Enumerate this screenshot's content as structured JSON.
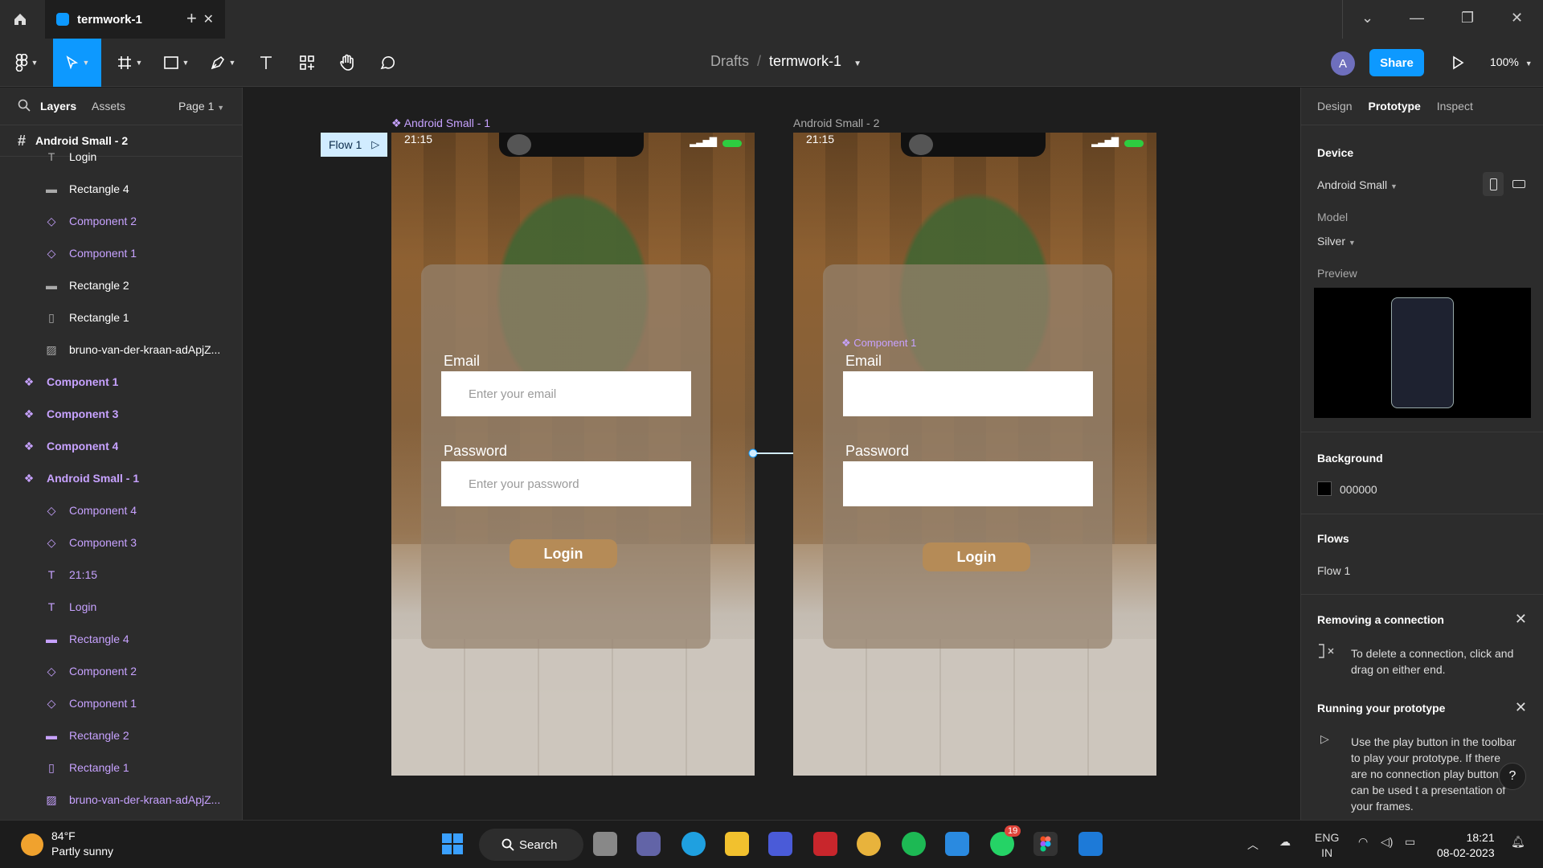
{
  "titlebar": {
    "tab_title": "termwork-1",
    "tab_close": "✕",
    "new_tab": "+",
    "window_controls": [
      "⌄",
      "—",
      "❐",
      "✕"
    ]
  },
  "toolbar": {
    "breadcrumb_drafts": "Drafts",
    "breadcrumb_sep": "/",
    "file_name": "termwork-1",
    "avatar_initial": "A",
    "share_label": "Share",
    "zoom": "100%"
  },
  "left_panel": {
    "tabs": {
      "layers": "Layers",
      "assets": "Assets",
      "page": "Page 1"
    },
    "selected_frame": "Android Small - 2",
    "layers": [
      {
        "name": "Login",
        "icon": "text-icon",
        "component": false,
        "bold": false
      },
      {
        "name": "Rectangle 4",
        "icon": "line-icon",
        "component": false,
        "bold": false
      },
      {
        "name": "Component 2",
        "icon": "instance-icon",
        "component": true,
        "bold": false
      },
      {
        "name": "Component 1",
        "icon": "instance-icon",
        "component": true,
        "bold": false
      },
      {
        "name": "Rectangle 2",
        "icon": "line-icon",
        "component": false,
        "bold": false
      },
      {
        "name": "Rectangle 1",
        "icon": "rect-icon",
        "component": false,
        "bold": false
      },
      {
        "name": "bruno-van-der-kraan-adApjZ...",
        "icon": "image-icon",
        "component": false,
        "bold": false
      },
      {
        "name": "Component 1",
        "icon": "component-icon",
        "component": true,
        "bold": true
      },
      {
        "name": "Component 3",
        "icon": "component-icon",
        "component": true,
        "bold": true
      },
      {
        "name": "Component 4",
        "icon": "component-icon",
        "component": true,
        "bold": true
      },
      {
        "name": "Android Small - 1",
        "icon": "component-icon",
        "component": true,
        "bold": true
      },
      {
        "name": "Component 4",
        "icon": "instance-icon",
        "component": true,
        "bold": false
      },
      {
        "name": "Component 3",
        "icon": "instance-icon",
        "component": true,
        "bold": false
      },
      {
        "name": "21:15",
        "icon": "text-icon",
        "component": true,
        "bold": false
      },
      {
        "name": "Login",
        "icon": "text-icon",
        "component": true,
        "bold": false
      },
      {
        "name": "Rectangle 4",
        "icon": "line-icon",
        "component": true,
        "bold": false
      },
      {
        "name": "Component 2",
        "icon": "instance-icon",
        "component": true,
        "bold": false
      },
      {
        "name": "Component 1",
        "icon": "instance-icon",
        "component": true,
        "bold": false
      },
      {
        "name": "Rectangle 2",
        "icon": "line-icon",
        "component": true,
        "bold": false
      },
      {
        "name": "Rectangle 1",
        "icon": "rect-icon",
        "component": true,
        "bold": false
      },
      {
        "name": "bruno-van-der-kraan-adApjZ...",
        "icon": "image-icon",
        "component": true,
        "bold": false
      }
    ]
  },
  "canvas": {
    "flow_tag": "Flow 1",
    "frame1": {
      "label": "Android Small - 1",
      "time": "21:15",
      "email_label": "Email",
      "email_placeholder": "Enter your email",
      "password_label": "Password",
      "password_placeholder": "Enter your password",
      "login": "Login"
    },
    "frame2": {
      "label": "Android Small - 2",
      "time": "21:15",
      "component_ghost": "Component 1",
      "email_label": "Email",
      "password_label": "Password",
      "login": "Login"
    }
  },
  "right_panel": {
    "tabs": [
      "Design",
      "Prototype",
      "Inspect"
    ],
    "device_heading": "Device",
    "device_value": "Android Small",
    "model_label": "Model",
    "model_value": "Silver",
    "preview_label": "Preview",
    "background_heading": "Background",
    "background_hex": "000000",
    "flows_heading": "Flows",
    "flow_item": "Flow 1",
    "tip1_title": "Removing a connection",
    "tip1_text": "To delete a connection, click and drag on either end.",
    "tip2_title": "Running your prototype",
    "tip2_text": "Use the play button in the toolbar to play your prototype. If there are no connection play button can be used t a presentation of your frames.",
    "help": "?"
  },
  "taskbar": {
    "temp": "84°F",
    "condition": "Partly sunny",
    "search": "Search",
    "whatsapp_badge": "19",
    "lang1": "ENG",
    "lang2": "IN",
    "time": "18:21",
    "date": "08-02-2023"
  },
  "colors": {
    "accent": "#0d99ff",
    "component": "#c7a2ff",
    "login_button": "#b58b57"
  }
}
